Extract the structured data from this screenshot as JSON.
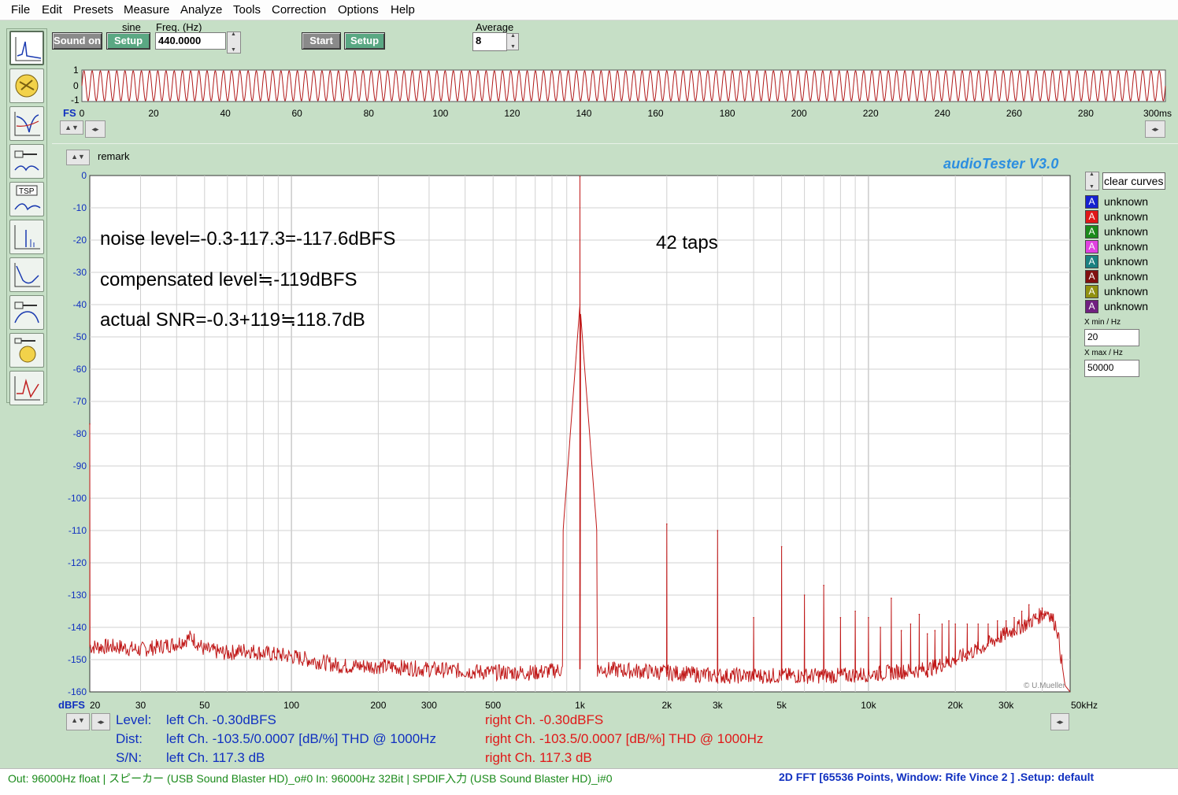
{
  "menu": [
    "File",
    "Edit",
    "Presets",
    "Measure",
    "Analyze",
    "Tools",
    "Correction",
    "Options",
    "Help"
  ],
  "generator": {
    "sound_on_label": "Sound on",
    "waveform_label": "sine",
    "setup_label": "Setup",
    "freq_label": "Freq. (Hz)",
    "freq_value": "440.0000"
  },
  "analyzer": {
    "start_label": "Start",
    "setup_label": "Setup",
    "average_label": "Average",
    "average_value": "8"
  },
  "waveform": {
    "y_labels": [
      "1",
      "0",
      "-1"
    ],
    "fs_label": "FS",
    "x_ticks": [
      "0",
      "20",
      "40",
      "60",
      "80",
      "100",
      "120",
      "140",
      "160",
      "180",
      "200",
      "220",
      "240",
      "260",
      "280",
      "300ms"
    ],
    "color": "#b01818"
  },
  "remark_label": "remark",
  "brand": "audioTester  V3.0",
  "copyright": "© U.Mueller",
  "legend": {
    "clear_label": "clear curves",
    "items": [
      {
        "label": "unknown",
        "color": "#1520d0"
      },
      {
        "label": "unknown",
        "color": "#e01818"
      },
      {
        "label": "unknown",
        "color": "#1a8a1a"
      },
      {
        "label": "unknown",
        "color": "#e040e0"
      },
      {
        "label": "unknown",
        "color": "#1a8080"
      },
      {
        "label": "unknown",
        "color": "#801010"
      },
      {
        "label": "unknown",
        "color": "#909010"
      },
      {
        "label": "unknown",
        "color": "#702080"
      }
    ],
    "xmin_label": "X min / Hz",
    "xmin_value": "20",
    "xmax_label": "X max / Hz",
    "xmax_value": "50000"
  },
  "annotations": {
    "line1": "noise level=-0.3-117.3=-117.6dBFS",
    "line2": "compensated level≒-119dBFS",
    "line3": "actual SNR=-0.3+119≒118.7dB",
    "taps": "42 taps"
  },
  "chart_data": {
    "type": "line",
    "title": "",
    "xlabel": "",
    "ylabel": "dBFS",
    "x_scale": "log",
    "xlim": [
      20,
      50000
    ],
    "ylim": [
      -160,
      0
    ],
    "x_tick_labels": [
      "20",
      "30",
      "50",
      "100",
      "200",
      "300",
      "500",
      "1k",
      "2k",
      "3k",
      "5k",
      "10k",
      "20k",
      "30k",
      "50kHz"
    ],
    "x_tick_values": [
      20,
      30,
      50,
      100,
      200,
      300,
      500,
      1000,
      2000,
      3000,
      5000,
      10000,
      20000,
      30000,
      50000
    ],
    "y_tick_labels": [
      "0",
      "-10",
      "-20",
      "-30",
      "-40",
      "-50",
      "-60",
      "-70",
      "-80",
      "-90",
      "-100",
      "-110",
      "-120",
      "-130",
      "-140",
      "-150",
      "-160"
    ],
    "grid": true,
    "series": [
      {
        "color": "#c01818",
        "noise_floor": [
          [
            20,
            -146
          ],
          [
            25,
            -146
          ],
          [
            30,
            -147
          ],
          [
            40,
            -145
          ],
          [
            45,
            -143
          ],
          [
            50,
            -147
          ],
          [
            60,
            -148
          ],
          [
            70,
            -147
          ],
          [
            80,
            -148
          ],
          [
            100,
            -149
          ],
          [
            150,
            -152
          ],
          [
            200,
            -152
          ],
          [
            300,
            -153
          ],
          [
            500,
            -154
          ],
          [
            700,
            -154
          ],
          [
            900,
            -153
          ],
          [
            1200,
            -153
          ],
          [
            2000,
            -154
          ],
          [
            3000,
            -155
          ],
          [
            5000,
            -155
          ],
          [
            8000,
            -155
          ],
          [
            12000,
            -154
          ],
          [
            16000,
            -153
          ],
          [
            20000,
            -150
          ],
          [
            25000,
            -146
          ],
          [
            30000,
            -142
          ],
          [
            35000,
            -139
          ],
          [
            40000,
            -136
          ],
          [
            42000,
            -135
          ],
          [
            45000,
            -140
          ],
          [
            48000,
            -158
          ],
          [
            50000,
            -160
          ]
        ],
        "peaks": [
          {
            "x": 20,
            "y": -77
          },
          {
            "x": 1000,
            "y": -0.3
          },
          {
            "x": 2000,
            "y": -108
          },
          {
            "x": 3000,
            "y": -110
          },
          {
            "x": 4000,
            "y": -137
          },
          {
            "x": 5000,
            "y": -115
          },
          {
            "x": 6000,
            "y": -130
          },
          {
            "x": 7000,
            "y": -127
          },
          {
            "x": 8000,
            "y": -137
          },
          {
            "x": 9000,
            "y": -135
          },
          {
            "x": 10000,
            "y": -137
          },
          {
            "x": 11000,
            "y": -140
          },
          {
            "x": 12000,
            "y": -131
          },
          {
            "x": 13000,
            "y": -141
          },
          {
            "x": 14000,
            "y": -139
          },
          {
            "x": 15000,
            "y": -136
          },
          {
            "x": 16000,
            "y": -142
          },
          {
            "x": 17000,
            "y": -141
          },
          {
            "x": 18000,
            "y": -139
          },
          {
            "x": 19000,
            "y": -138
          },
          {
            "x": 20000,
            "y": -139
          },
          {
            "x": 22000,
            "y": -139
          },
          {
            "x": 24000,
            "y": -139
          },
          {
            "x": 26000,
            "y": -139
          },
          {
            "x": 28000,
            "y": -138
          },
          {
            "x": 30000,
            "y": -138
          },
          {
            "x": 32000,
            "y": -137
          },
          {
            "x": 34000,
            "y": -135
          },
          {
            "x": 36000,
            "y": -133
          },
          {
            "x": 38000,
            "y": -136
          },
          {
            "x": 40000,
            "y": -134
          }
        ]
      }
    ]
  },
  "readout": {
    "level_label": "Level:",
    "dist_label": "Dist:",
    "sn_label": "S/N:",
    "left_level": "left Ch. -0.30dBFS",
    "left_dist": "left Ch. -103.5/0.0007 [dB/%] THD @ 1000Hz",
    "left_sn": "left Ch. 117.3 dB",
    "right_level": "right Ch. -0.30dBFS",
    "right_dist": "right Ch. -103.5/0.0007 [dB/%] THD @ 1000Hz",
    "right_sn": "right Ch. 117.3 dB"
  },
  "statusbar": {
    "left": "Out: 96000Hz float  | スピーカー (USB Sound Blaster HD)_o#0  In: 96000Hz 32Bit  | SPDIF入力 (USB Sound Blaster HD)_i#0",
    "right": "2D FFT [65536 Points, Window: Rife Vince 2 ]  .Setup:  default"
  }
}
